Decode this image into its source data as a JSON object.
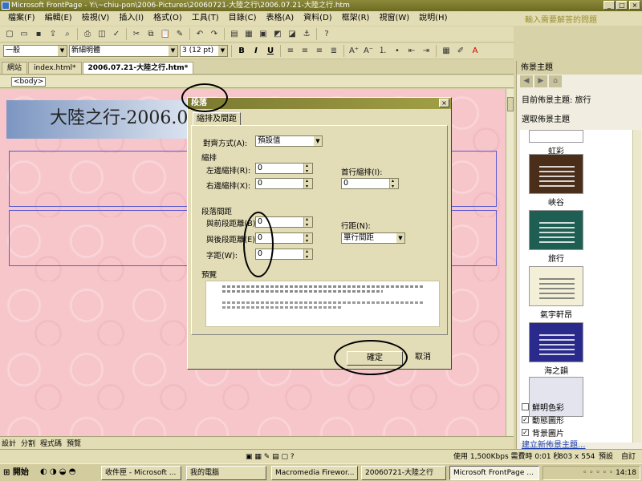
{
  "window": {
    "title": "Microsoft FrontPage - Y:\\~chiu-pon\\2006-Pictures\\20060721-大陸之行\\2006.07.21-大陸之行.htm"
  },
  "menu": [
    "檔案(F)",
    "編輯(E)",
    "檢視(V)",
    "插入(I)",
    "格式(O)",
    "工具(T)",
    "目錄(C)",
    "表格(A)",
    "資料(D)",
    "框架(R)",
    "視窗(W)",
    "說明(H)"
  ],
  "help_prompt": "輸入需要解答的問題",
  "format_toolbar": {
    "style": "一般",
    "font": "新細明體",
    "size": "3  (12 pt)"
  },
  "doc_tabs": [
    "網站",
    "index.html*",
    "2006.07.21-大陸之行.htm*"
  ],
  "tag_selector": "<body>",
  "editor": {
    "banner_title": "大陸之行-2006.0"
  },
  "view_tabs": [
    "設計",
    "分割",
    "程式碼",
    "預覽"
  ],
  "status": {
    "speed": "使用 1,500Kbps 需費時 0:01 秒",
    "dimensions": "803 x 554",
    "mode1": "預設",
    "mode2": "自訂"
  },
  "task_pane": {
    "title": "佈景主題",
    "current_theme": "目前佈景主題: 旅行",
    "select_label": "選取佈景主題",
    "themes": [
      "虹彩",
      "峽谷",
      "旅行",
      "氣宇軒昂",
      "海之韻"
    ],
    "options": [
      {
        "label": "鮮明色彩",
        "checked": false
      },
      {
        "label": "動態圖形",
        "checked": true
      },
      {
        "label": "背景圖片",
        "checked": true
      }
    ],
    "new_theme_link": "建立新佈景主題..."
  },
  "dialog": {
    "title": "段落",
    "tab": "縮排及間距",
    "alignment_label": "對齊方式(A):",
    "alignment_value": "預設值",
    "indent_header": "縮排",
    "left_indent_label": "左邊縮排(R):",
    "left_indent_value": "0",
    "right_indent_label": "右邊縮排(X):",
    "right_indent_value": "0",
    "first_line_label": "首行縮排(I):",
    "first_line_value": "0",
    "spacing_header": "段落間距",
    "before_label": "與前段距離(B):",
    "before_value": "0",
    "after_label": "與後段距離(E):",
    "after_value": "0",
    "word_label": "字距(W):",
    "word_value": "0",
    "line_spacing_label": "行距(N):",
    "line_spacing_value": "單行間距",
    "preview_label": "預覽",
    "ok_label": "確定",
    "cancel_label": "取消"
  },
  "taskbar": {
    "start": "開始",
    "buttons": [
      "收件匣 - Microsoft ...",
      "我的電腦",
      "Macromedia Firewor...",
      "20060721-大陸之行",
      "Microsoft FrontPage ..."
    ],
    "clock": "14:18"
  }
}
